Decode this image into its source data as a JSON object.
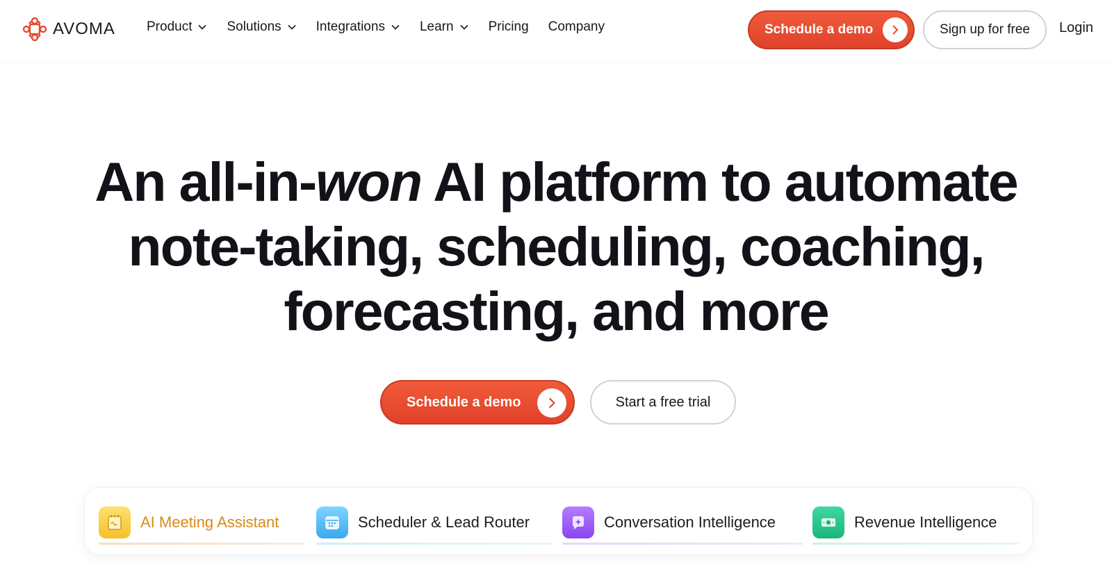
{
  "header": {
    "logo_text": "AVOMA",
    "nav": [
      {
        "label": "Product",
        "dropdown": true
      },
      {
        "label": "Solutions",
        "dropdown": true
      },
      {
        "label": "Integrations",
        "dropdown": true
      },
      {
        "label": "Learn",
        "dropdown": true
      },
      {
        "label": "Pricing",
        "dropdown": false
      },
      {
        "label": "Company",
        "dropdown": false
      }
    ],
    "demo_label": "Schedule a demo",
    "signup_label": "Sign up for free",
    "login_label": "Login"
  },
  "hero": {
    "line1_a": "An all-in-",
    "line1_em": "won",
    "line1_b": " AI platform to automate",
    "line2": "note-taking, scheduling, coaching,",
    "line3": "forecasting, and more"
  },
  "cta": {
    "demo_label": "Schedule a demo",
    "trial_label": "Start a free trial"
  },
  "tabs": [
    {
      "label": "AI Meeting Assistant",
      "icon": "notepad-icon",
      "active": true
    },
    {
      "label": "Scheduler & Lead Router",
      "icon": "calendar-icon",
      "active": false
    },
    {
      "label": "Conversation Intelligence",
      "icon": "sparkle-chat-icon",
      "active": false
    },
    {
      "label": "Revenue Intelligence",
      "icon": "money-icon",
      "active": false
    }
  ],
  "colors": {
    "brand": "#e8482d",
    "active_tab_text": "#d98a16"
  }
}
